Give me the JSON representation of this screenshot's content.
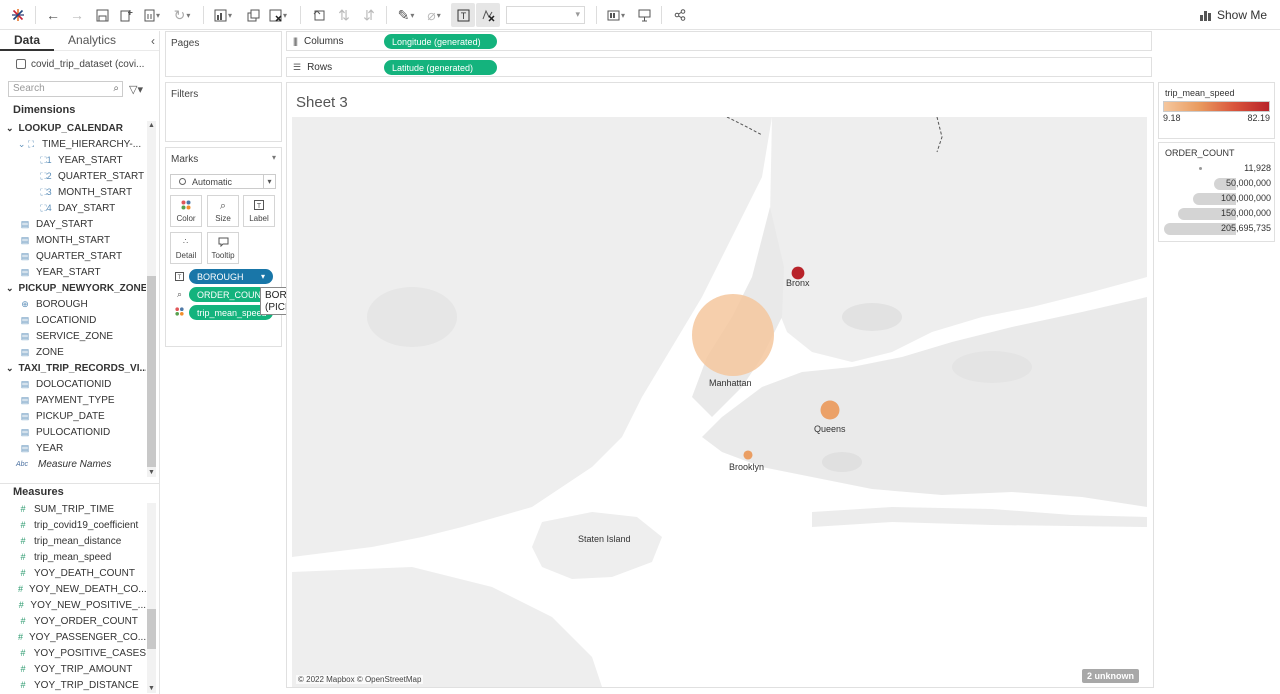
{
  "toolbar": {
    "icons": [
      "tableau-logo-icon",
      "undo-icon",
      "redo-icon",
      "save-icon",
      "new-datasource-icon",
      "pause-updates-icon",
      "refresh-icon",
      "new-worksheet-icon",
      "duplicate-icon",
      "clear-sheet-icon",
      "swap-icon",
      "sort-ascending-icon",
      "sort-descending-icon",
      "highlight-icon",
      "group-icon",
      "show-labels-icon",
      "fix-axes-icon",
      "fit-dropdown",
      "show-cards-icon",
      "presentation-icon",
      "share-icon"
    ],
    "show_me": "Show Me"
  },
  "data_pane": {
    "tabs": [
      "Data",
      "Analytics"
    ],
    "datasource": "covid_trip_dataset (covi...",
    "search_placeholder": "Search",
    "dimensions_header": "Dimensions",
    "measures_header": "Measures",
    "dimensions": [
      {
        "label": "LOOKUP_CALENDAR",
        "type": "table"
      },
      {
        "label": "TIME_HIERARCHY-...",
        "type": "hierarchy"
      },
      {
        "label": "YEAR_START",
        "type": "level",
        "level": "1"
      },
      {
        "label": "QUARTER_START",
        "type": "level",
        "level": "2"
      },
      {
        "label": "MONTH_START",
        "type": "level",
        "level": "3"
      },
      {
        "label": "DAY_START",
        "type": "level",
        "level": "4"
      },
      {
        "label": "DAY_START",
        "type": "date"
      },
      {
        "label": "MONTH_START",
        "type": "date"
      },
      {
        "label": "QUARTER_START",
        "type": "date"
      },
      {
        "label": "YEAR_START",
        "type": "date"
      },
      {
        "label": "PICKUP_NEWYORK_ZONE",
        "type": "table"
      },
      {
        "label": "BOROUGH",
        "type": "geo"
      },
      {
        "label": "LOCATIONID",
        "type": "date"
      },
      {
        "label": "SERVICE_ZONE",
        "type": "date"
      },
      {
        "label": "ZONE",
        "type": "date"
      },
      {
        "label": "TAXI_TRIP_RECORDS_VI...",
        "type": "table"
      },
      {
        "label": "DOLOCATIONID",
        "type": "date"
      },
      {
        "label": "PAYMENT_TYPE",
        "type": "date"
      },
      {
        "label": "PICKUP_DATE",
        "type": "date"
      },
      {
        "label": "PULOCATIONID",
        "type": "date"
      },
      {
        "label": "YEAR",
        "type": "date"
      },
      {
        "label": "Measure Names",
        "type": "abc"
      }
    ],
    "measures": [
      "SUM_TRIP_TIME",
      "trip_covid19_coefficient",
      "trip_mean_distance",
      "trip_mean_speed",
      "YOY_DEATH_COUNT",
      "YOY_NEW_DEATH_CO...",
      "YOY_NEW_POSITIVE_...",
      "YOY_ORDER_COUNT",
      "YOY_PASSENGER_CO...",
      "YOY_POSITIVE_CASES",
      "YOY_TRIP_AMOUNT",
      "YOY_TRIP_DISTANCE"
    ]
  },
  "cards": {
    "pages": "Pages",
    "filters": "Filters",
    "marks": "Marks",
    "mark_type": "Automatic",
    "buttons": [
      "Color",
      "Size",
      "Label",
      "Detail",
      "Tooltip"
    ],
    "pills": [
      {
        "label": "BOROUGH",
        "color": "#1976a8"
      },
      {
        "label": "ORDER_COUNT",
        "color": "#14b37d"
      },
      {
        "label": "trip_mean_speed",
        "color": "#14b37d"
      }
    ],
    "tooltip_line1": "BOROUGH",
    "tooltip_line2": "(PICKUP_NEWYORK_ZONE)"
  },
  "shelves": {
    "columns_label": "Columns",
    "rows_label": "Rows",
    "columns_pill": "Longitude (generated)",
    "rows_pill": "Latitude (generated)"
  },
  "view": {
    "sheet_title": "Sheet 3",
    "attribution": "© 2022 Mapbox © OpenStreetMap",
    "unknown_badge": "2 unknown",
    "boroughs": [
      {
        "name": "Bronx",
        "order_count": 5000000,
        "speed": 82.19
      },
      {
        "name": "Manhattan",
        "order_count": 205695735,
        "speed": 9.18
      },
      {
        "name": "Queens",
        "order_count": 11000000,
        "speed": 30.0
      },
      {
        "name": "Brooklyn",
        "order_count": 2500000,
        "speed": 32.0
      },
      {
        "name": "Staten Island",
        "order_count": null,
        "speed": null
      }
    ]
  },
  "legends": {
    "color_title": "trip_mean_speed",
    "color_min": "9.18",
    "color_max": "82.19",
    "size_title": "ORDER_COUNT",
    "size_values": [
      "11,928",
      "50,000,000",
      "100,000,000",
      "150,000,000",
      "205,695,735"
    ],
    "size_fractions": [
      0.0,
      0.3,
      0.6,
      0.8,
      1.0
    ]
  }
}
